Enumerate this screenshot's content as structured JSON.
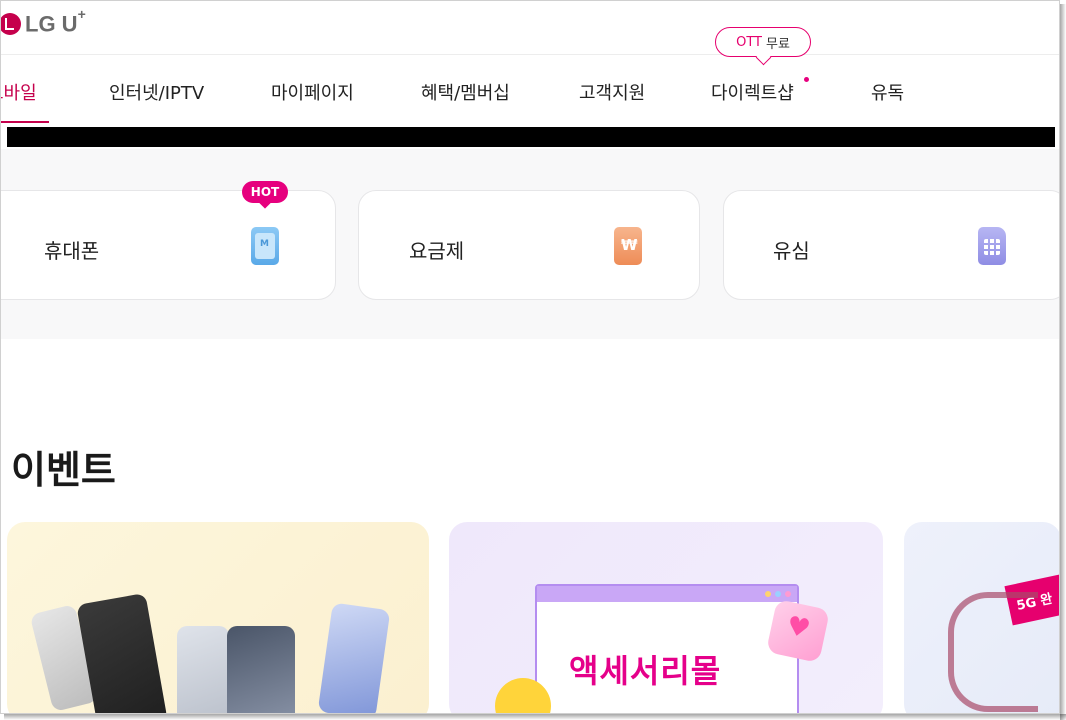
{
  "header": {
    "logo_text": "LG U",
    "logo_sup": "+"
  },
  "nav": {
    "items": [
      {
        "label": "모바일",
        "active": true
      },
      {
        "label": "인터넷/IPTV"
      },
      {
        "label": "마이페이지"
      },
      {
        "label": "혜택/멤버십"
      },
      {
        "label": "고객지원"
      },
      {
        "label": "다이렉트샵"
      },
      {
        "label": "유독"
      }
    ],
    "ott_badge": {
      "ott": "OTT",
      "free": "무료"
    }
  },
  "quick_menu": {
    "hot_label": "HOT",
    "cards": [
      {
        "label": "휴대폰",
        "icon": "phone-icon"
      },
      {
        "label": "요금제",
        "icon": "won-plan-icon"
      },
      {
        "label": "유심",
        "icon": "sim-card-icon"
      }
    ]
  },
  "events": {
    "title": "이벤트",
    "banners": [
      {
        "name": "smartphone-banner"
      },
      {
        "name": "accessory-mall-banner",
        "headline": "액세서리몰"
      },
      {
        "name": "5g-banner",
        "badge": "5G 완"
      }
    ]
  },
  "colors": {
    "brand": "#c5004c",
    "accent_pink": "#e6007e"
  }
}
